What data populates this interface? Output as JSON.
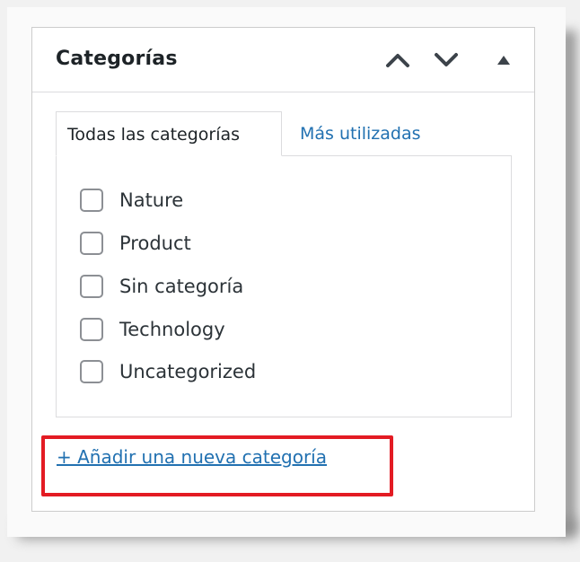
{
  "panel": {
    "title": "Categorías",
    "controls": {
      "move_up_icon": "chevron-up-icon",
      "move_down_icon": "chevron-down-icon",
      "toggle_icon": "triangle-up-icon"
    }
  },
  "tabs": [
    {
      "label": "Todas las categorías",
      "active": true
    },
    {
      "label": "Más utilizadas",
      "active": false
    }
  ],
  "categories": [
    {
      "label": "Nature",
      "checked": false
    },
    {
      "label": "Product",
      "checked": false
    },
    {
      "label": "Sin categoría",
      "checked": false
    },
    {
      "label": "Technology",
      "checked": false
    },
    {
      "label": "Uncategorized",
      "checked": false
    }
  ],
  "add_category_link": "+ Añadir una nueva categoría",
  "colors": {
    "link": "#2271b1",
    "highlight": "#e31b23",
    "border": "#dcdcde",
    "text": "#1d2327"
  }
}
